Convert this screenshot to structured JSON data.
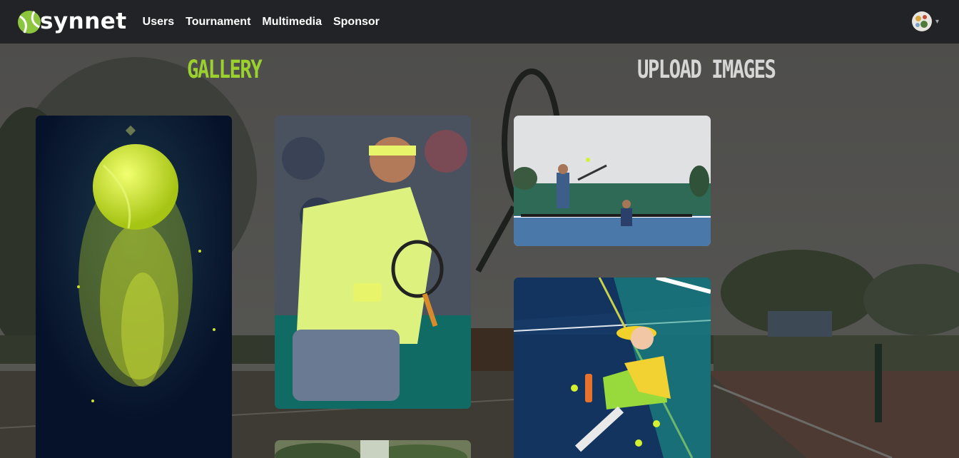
{
  "brand": {
    "name": "synnet"
  },
  "nav": {
    "items": [
      {
        "label": "Users"
      },
      {
        "label": "Tournament"
      },
      {
        "label": "Multimedia"
      },
      {
        "label": "Sponsor"
      }
    ]
  },
  "user_menu": {
    "avatar_icon": "avatar-icon",
    "caret": "▾"
  },
  "page": {
    "gallery_title": "GALLERY",
    "upload_title": "UPLOAD IMAGES"
  },
  "gallery": {
    "images": [
      {
        "name": "tennis-ball-explosion"
      },
      {
        "name": "tennis-player-headband"
      },
      {
        "name": "doubles-match-court"
      },
      {
        "name": "player-sitting-by-net"
      },
      {
        "name": "trees-outdoor"
      }
    ]
  },
  "colors": {
    "navbar": "#222327",
    "accent": "#9bd12e",
    "upload_heading": "#d6d6d6"
  }
}
